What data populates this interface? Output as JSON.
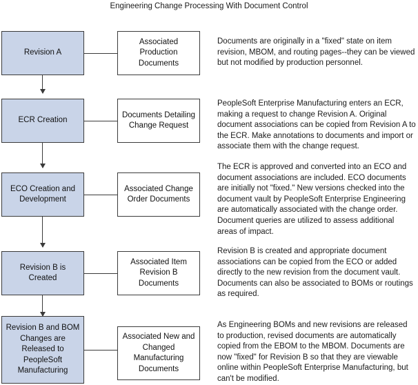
{
  "diagram": {
    "title": "Engineering Change Processing With Document Control",
    "colors": {
      "process_box_fill": "#c9d4e8",
      "box_border": "#3a3a3a",
      "document_box_fill": "#ffffff",
      "text": "#1a1a1a"
    },
    "steps": [
      {
        "process": "Revision A",
        "document": "Associated Production Documents",
        "description": "Documents are originally in a \"fixed\" state on item revision, MBOM, and routing pages--they can be viewed but not modified by production personnel."
      },
      {
        "process": "ECR Creation",
        "document": "Documents Detailing Change Request",
        "description": "PeopleSoft Enterprise Manufacturing enters an ECR, making a request to change Revision A.  Original document associations can be copied from Revision A to the ECR.  Make annotations to documents and import or associate them with the change request."
      },
      {
        "process": "ECO Creation and Development",
        "document": "Associated Change Order Documents",
        "description": "The ECR is approved and converted into an ECO and document associations are included.  ECO documents are initially not \"fixed.\"  New versions checked into the document vault by PeopleSoft Enterprise Engineering are automatically associated with the change order.  Document queries are utilized to assess additional areas of impact."
      },
      {
        "process": "Revision B is Created",
        "document": "Associated Item Revision B Documents",
        "description": "Revision B is created and appropriate document associations can be copied from the ECO or added directly to the new revision from the document vault. Documents can also be associated to BOMs or routings as required."
      },
      {
        "process": "Revision B and BOM Changes are Released to PeopleSoft Manufacturing",
        "document": "Associated New and Changed Manufacturing Documents",
        "description": "As Engineering BOMs and new revisions are released to production, revised documents are automatically copied from the EBOM to the MBOM. Documents are now \"fixed\" for Revision B so that they are viewable online within PeopleSoft Enterprise Manufacturing, but can't be modified."
      }
    ]
  }
}
